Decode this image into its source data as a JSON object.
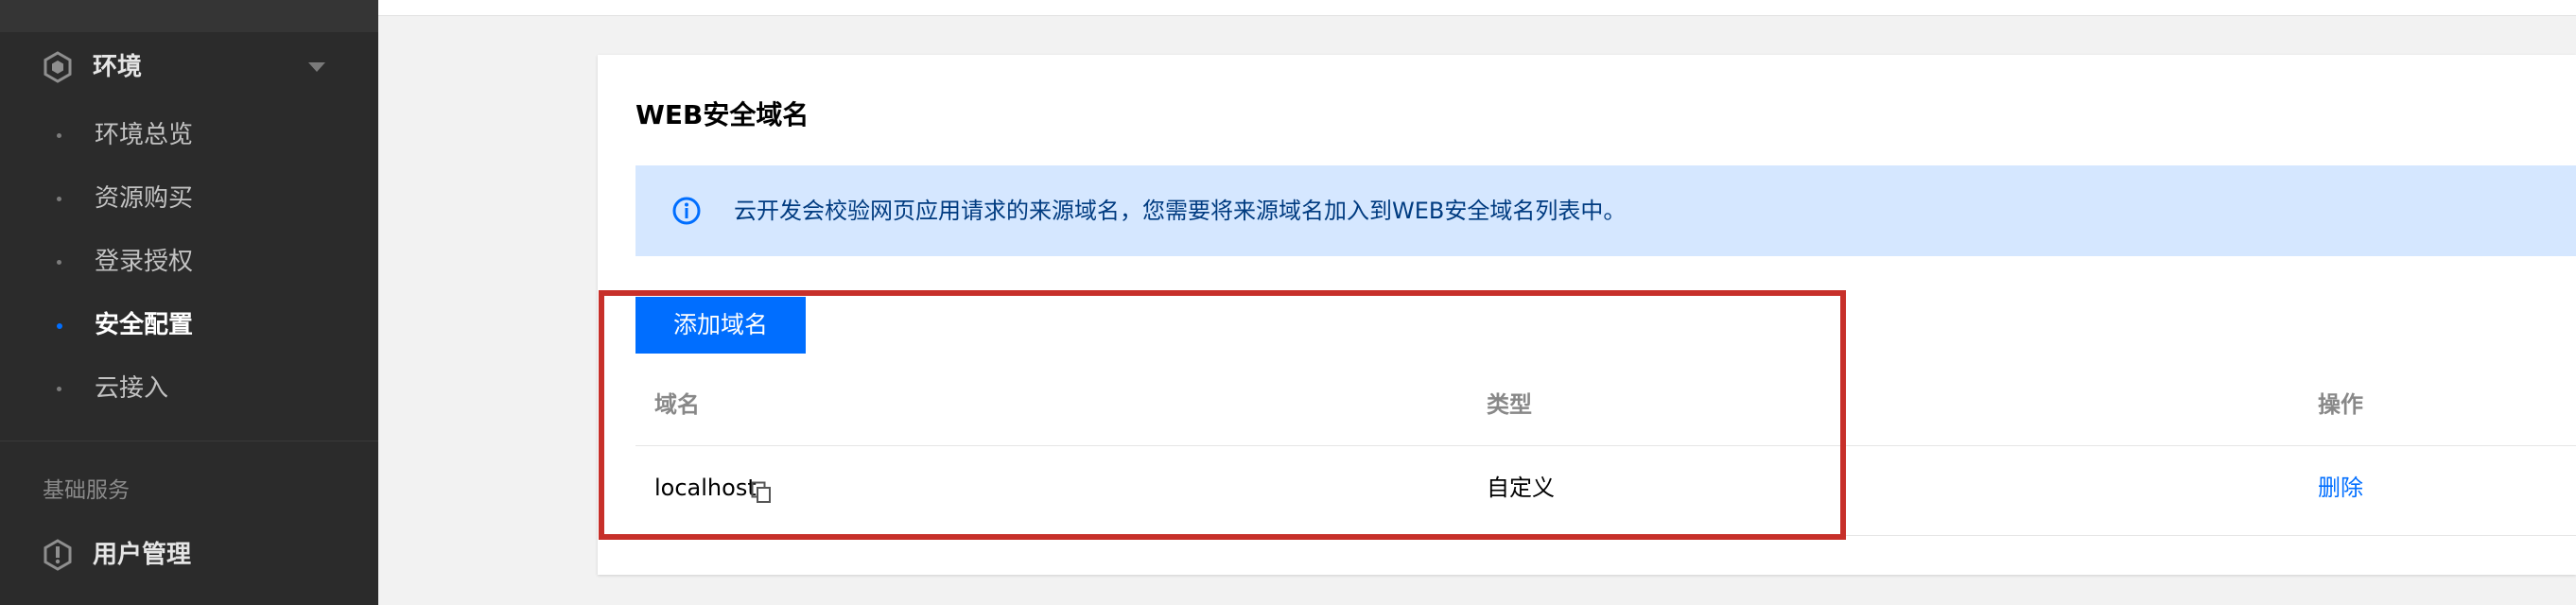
{
  "sidebar": {
    "group": {
      "label": "环境",
      "icon": "hexagon-icon"
    },
    "items": [
      {
        "label": "环境总览",
        "active": false
      },
      {
        "label": "资源购买",
        "active": false
      },
      {
        "label": "登录授权",
        "active": false
      },
      {
        "label": "安全配置",
        "active": true
      },
      {
        "label": "云接入",
        "active": false
      }
    ],
    "section_label": "基础服务",
    "user_management": {
      "label": "用户管理",
      "icon": "user-shield-icon"
    }
  },
  "card": {
    "title": "WEB安全域名",
    "alert": {
      "icon": "info-icon",
      "text": "云开发会校验网页应用请求的来源域名，您需要将来源域名加入到WEB安全域名列表中。"
    },
    "add_button_label": "添加域名",
    "table": {
      "columns": [
        "域名",
        "类型",
        "操作"
      ],
      "rows": [
        {
          "domain": "localhost",
          "type": "自定义",
          "action": "删除"
        }
      ]
    }
  },
  "colors": {
    "sidebar_bg": "#2b2b2b",
    "primary": "#006eff",
    "alert_bg": "#d5e7ff",
    "highlight": "#c7302a"
  }
}
